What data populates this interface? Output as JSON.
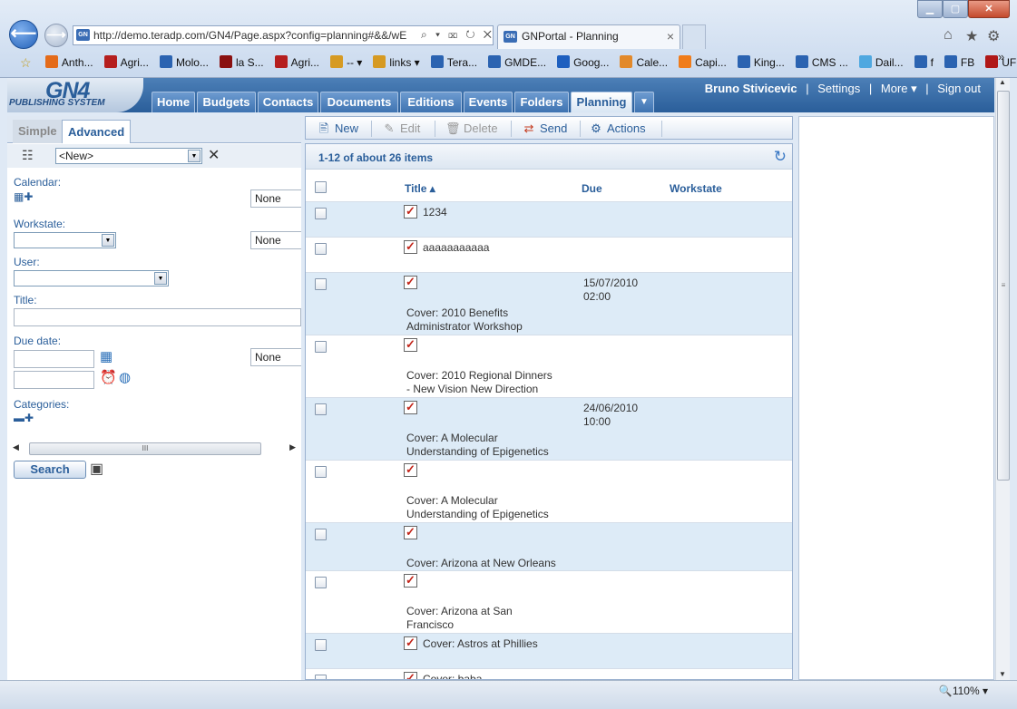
{
  "browser": {
    "url": "http://demo.teradp.com/GN4/Page.aspx?config=planning#&&/wE",
    "tab_title": "GNPortal - Planning",
    "tab_close": "×",
    "win_min": "▁",
    "win_max": "▢",
    "win_close": "✕",
    "address_icons": "⌕ ▾ ⌧ ↻ ✕",
    "favorites": [
      {
        "label": "Anth...",
        "color": "#e46b1a"
      },
      {
        "label": "Agri...",
        "color": "#b51e1e"
      },
      {
        "label": "Molo...",
        "color": "#2b63b1"
      },
      {
        "label": "la S...",
        "color": "#8a1010"
      },
      {
        "label": "Agri...",
        "color": "#b51e1e"
      },
      {
        "label": "-- ▾",
        "color": "#d69a22"
      },
      {
        "label": "links ▾",
        "color": "#d69a22"
      },
      {
        "label": "Tera...",
        "color": "#2b63b1"
      },
      {
        "label": "GMDE...",
        "color": "#2b63b1"
      },
      {
        "label": "Goog...",
        "color": "#1e5fbf"
      },
      {
        "label": "Cale...",
        "color": "#e2892a"
      },
      {
        "label": "Capi...",
        "color": "#f07c1a"
      },
      {
        "label": "King...",
        "color": "#2b63b1"
      },
      {
        "label": "CMS ...",
        "color": "#2b63b1"
      },
      {
        "label": "Dail...",
        "color": "#4fa8e0"
      },
      {
        "label": "f",
        "color": "#2b63b1"
      },
      {
        "label": "FB",
        "color": "#2b63b1"
      },
      {
        "label": "UF",
        "color": "#b01818"
      }
    ],
    "fav_more": "»",
    "zoom": "🔍110% ▾"
  },
  "app": {
    "logo_main": "GN4",
    "logo_sub": "PUBLISHING SYSTEM",
    "nav_tabs": [
      "Home",
      "Budgets",
      "Contacts",
      "Documents",
      "Editions",
      "Events",
      "Folders",
      "Planning"
    ],
    "nav_more": "▼",
    "user_name": "Bruno Stivicevic",
    "settings": "Settings",
    "more": "More ▾",
    "sign_out": "Sign out",
    "sep": "|"
  },
  "search_panel": {
    "tab_simple": "Simple",
    "tab_advanced": "Advanced",
    "saved_query": "<New>",
    "clear": "✕",
    "calendar_label": "Calendar:",
    "calendar_none": "None",
    "workstate_label": "Workstate:",
    "workstate_none": "None",
    "user_label": "User:",
    "title_label": "Title:",
    "due_label": "Due date:",
    "due_none": "None",
    "categories_label": "Categories:",
    "scroll_grip": "III",
    "search_btn": "Search"
  },
  "toolbar": {
    "new": "New",
    "edit": "Edit",
    "delete": "Delete",
    "send": "Send",
    "actions": "Actions"
  },
  "list": {
    "count": "1-12 of about 26 items",
    "col_title": "Title ▴",
    "col_due": "Due",
    "col_workstate": "Workstate",
    "rows": [
      {
        "title": "1234",
        "due": ""
      },
      {
        "title": "aaaaaaaaaaa",
        "due": ""
      },
      {
        "title": "Cover: 2010 Benefits\nAdministrator Workshop",
        "due": "15/07/2010\n02:00"
      },
      {
        "title": "Cover: 2010 Regional Dinners\n- New Vision New Direction",
        "due": ""
      },
      {
        "title": "Cover: A Molecular\nUnderstanding of Epigenetics",
        "due": "24/06/2010\n10:00"
      },
      {
        "title": "Cover: A Molecular\nUnderstanding of Epigenetics",
        "due": ""
      },
      {
        "title": "Cover: Arizona at New Orleans",
        "due": ""
      },
      {
        "title": "Cover: Arizona at San\nFrancisco",
        "due": ""
      },
      {
        "title": "Cover: Astros at Phillies",
        "due": ""
      },
      {
        "title": "Cover: baba",
        "due": ""
      }
    ]
  }
}
